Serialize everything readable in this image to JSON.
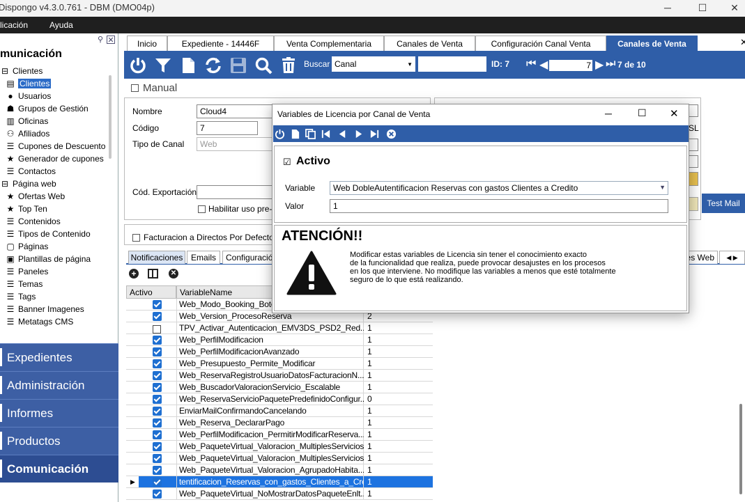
{
  "window": {
    "title": "Dispongo v4.3.0.761 - DBM (DMO04p)",
    "controls": {
      "minimize": "─",
      "maximize": "☐",
      "close": "✕"
    }
  },
  "menu": {
    "items": [
      "licación",
      "Ayuda"
    ]
  },
  "leftpanel": {
    "title": "municación",
    "tree": [
      {
        "label": "Clientes",
        "level": 0,
        "icon": "minus-icon"
      },
      {
        "label": "Clientes",
        "level": 1,
        "icon": "clients-icon",
        "selected": true
      },
      {
        "label": "Usuarios",
        "level": 1,
        "icon": "user-icon"
      },
      {
        "label": "Grupos de Gestión",
        "level": 1,
        "icon": "group-icon"
      },
      {
        "label": "Oficinas",
        "level": 1,
        "icon": "building-icon"
      },
      {
        "label": "Afiliados",
        "level": 1,
        "icon": "affiliate-icon"
      },
      {
        "label": "Cupones de Descuento",
        "level": 1,
        "icon": "list-icon"
      },
      {
        "label": "Generador de cupones",
        "level": 1,
        "icon": "star-icon"
      },
      {
        "label": "Contactos",
        "level": 1,
        "icon": "list-icon"
      },
      {
        "label": "Página web",
        "level": 0,
        "icon": "minus-icon"
      },
      {
        "label": "Ofertas Web",
        "level": 1,
        "icon": "star-icon"
      },
      {
        "label": "Top Ten",
        "level": 1,
        "icon": "star-icon"
      },
      {
        "label": "Contenidos",
        "level": 1,
        "icon": "list-icon"
      },
      {
        "label": "Tipos de Contenido",
        "level": 1,
        "icon": "list-icon"
      },
      {
        "label": "Páginas",
        "level": 1,
        "icon": "page-icon"
      },
      {
        "label": "Plantillas de página",
        "level": 1,
        "icon": "template-icon"
      },
      {
        "label": "Paneles",
        "level": 1,
        "icon": "list-icon"
      },
      {
        "label": "Temas",
        "level": 1,
        "icon": "list-icon"
      },
      {
        "label": "Tags",
        "level": 1,
        "icon": "list-icon"
      },
      {
        "label": "Banner Imagenes",
        "level": 1,
        "icon": "list-icon"
      },
      {
        "label": "Metatags CMS",
        "level": 1,
        "icon": "list-icon"
      }
    ],
    "nav": [
      "Expedientes",
      "Administración",
      "Informes",
      "Productos",
      "Comunicación"
    ]
  },
  "tabs": [
    "Inicio",
    "Expediente - 14446F",
    "Venta Complementaria",
    "Canales de Venta",
    "Configuración Canal Venta",
    "Canales de Venta"
  ],
  "toolbar": {
    "buscar_label": "Buscar",
    "buscar_field": "Canal",
    "search_value": "",
    "id_label": "ID: 7",
    "nav_value": "7",
    "nav_count": "7 de 10"
  },
  "form": {
    "manual_label": "Manual",
    "nombre_label": "Nombre",
    "nombre_value": "Cloud4",
    "codigo_label": "Código",
    "codigo_value": "7",
    "tipo_label": "Tipo de Canal",
    "tipo_value": "Web",
    "export_label": "Cód. Exportación",
    "export_value": "",
    "habilitar_label": "Habilitar uso pre-ca",
    "facturacion_label": "Facturacion a Directos Por Defecto",
    "sl_label": "SL",
    "testmail_label": "Test Mail"
  },
  "subtabs": [
    "Notificaciones",
    "Emails",
    "Configuració",
    "es Web"
  ],
  "grid": {
    "headers": [
      "Activo",
      "VariableName"
    ],
    "rows": [
      {
        "active": true,
        "name": "Web_Modo_Booking_Boto",
        "value": ""
      },
      {
        "active": true,
        "name": "Web_Version_ProcesoReserva",
        "value": "2"
      },
      {
        "active": false,
        "name": "TPV_Activar_Autenticacion_EMV3DS_PSD2_Red...",
        "value": "1"
      },
      {
        "active": true,
        "name": "Web_PerfilModificacion",
        "value": "1"
      },
      {
        "active": true,
        "name": "Web_PerfilModificacionAvanzado",
        "value": "1"
      },
      {
        "active": true,
        "name": "Web_Presupuesto_Permite_Modificar",
        "value": "1"
      },
      {
        "active": true,
        "name": "Web_ReservaRegistroUsuarioDatosFacturacionN...",
        "value": "1"
      },
      {
        "active": true,
        "name": "Web_BuscadorValoracionServicio_Escalable",
        "value": "1"
      },
      {
        "active": true,
        "name": "Web_ReservaServicioPaquetePredefinidoConfigur...",
        "value": "0"
      },
      {
        "active": true,
        "name": "EnviarMailConfirmandoCancelando",
        "value": "1"
      },
      {
        "active": true,
        "name": "Web_Reserva_DeclararPago",
        "value": "1"
      },
      {
        "active": true,
        "name": "Web_PerfilModificacion_PermitirModificarReserva...",
        "value": "1"
      },
      {
        "active": true,
        "name": "Web_PaqueteVirtual_Valoracion_MultiplesServicios",
        "value": "1"
      },
      {
        "active": true,
        "name": "Web_PaqueteVirtual_Valoracion_MultiplesServicios",
        "value": "1"
      },
      {
        "active": true,
        "name": "Web_PaqueteVirtual_Valoracion_AgrupadoHabita...",
        "value": "1"
      },
      {
        "active": true,
        "name": "tentificacion_Reservas_con_gastos_Clientes_a_Credito",
        "value": "1",
        "selected": true
      },
      {
        "active": true,
        "name": "Web_PaqueteVirtual_NoMostrarDatosPaqueteEnlt...",
        "value": "1"
      }
    ]
  },
  "dialog": {
    "title": "Variables de Licencia por Canal de Venta",
    "activo_label": "Activo",
    "variable_label": "Variable",
    "variable_value": "Web DobleAutentificacion Reservas con gastos Clientes a Credito",
    "valor_label": "Valor",
    "valor_value": "1",
    "warning_title": "ATENCIÓN!!",
    "warning_lines": [
      "Modificar estas variables de Licencia sin tener el conocimiento exacto",
      "de la funcionalidad que realiza, puede provocar desajustes en los procesos",
      "en los que interviene. No modifique las variables a menos que esté totalmente",
      "seguro de lo que está realizando."
    ]
  },
  "colors": {
    "accent": "#2f5ea8",
    "nav": "#3d5fa4",
    "selection": "#1d73e0"
  }
}
